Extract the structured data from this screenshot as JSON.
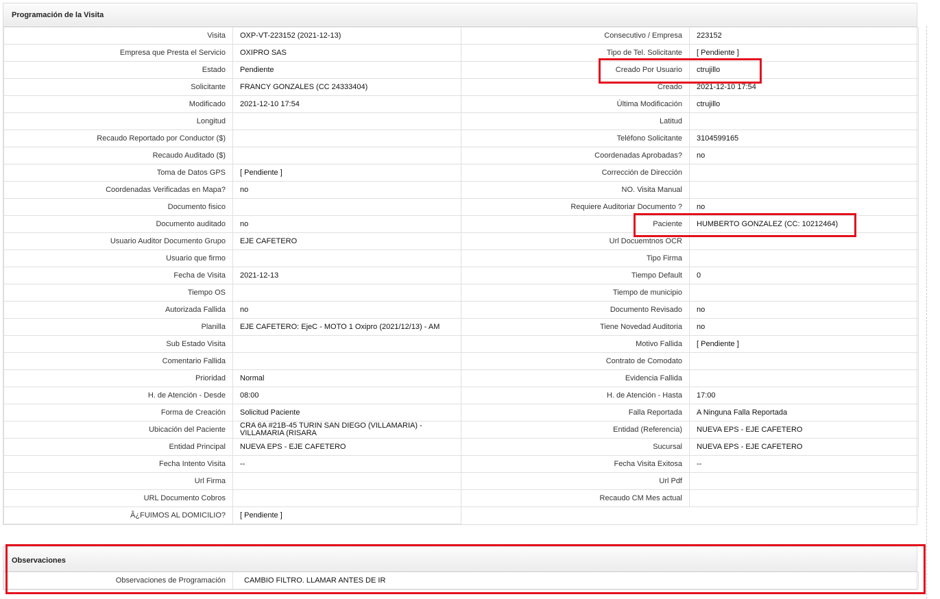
{
  "programacion": {
    "title": "Programación de la Visita",
    "rows": [
      {
        "l1": "Visita",
        "v1": "OXP-VT-223152 (2021-12-13)",
        "l2": "Consecutivo / Empresa",
        "v2": "223152"
      },
      {
        "l1": "Empresa que Presta el Servicio",
        "v1": "OXIPRO SAS",
        "l2": "Tipo de Tel. Solicitante",
        "v2": "[ Pendiente ]"
      },
      {
        "l1": "Estado",
        "v1": "Pendiente",
        "l2": "Creado Por Usuario",
        "v2": "ctrujillo"
      },
      {
        "l1": "Solicitante",
        "v1": "FRANCY GONZALES (CC 24333404)",
        "l2": "Creado",
        "v2": "2021-12-10 17:54"
      },
      {
        "l1": "Modificado",
        "v1": "2021-12-10 17:54",
        "l2": "Última Modificación",
        "v2": "ctrujillo"
      },
      {
        "l1": "Longitud",
        "v1": "",
        "l2": "Latitud",
        "v2": ""
      },
      {
        "l1": "Recaudo Reportado por Conductor ($)",
        "v1": "",
        "l2": "Teléfono Solicitante",
        "v2": "3104599165"
      },
      {
        "l1": "Recaudo Auditado ($)",
        "v1": "",
        "l2": "Coordenadas Aprobadas?",
        "v2": "no"
      },
      {
        "l1": "Toma de Datos GPS",
        "v1": "[ Pendiente ]",
        "l2": "Corrección de Dirección",
        "v2": ""
      },
      {
        "l1": "Coordenadas Verificadas en Mapa?",
        "v1": "no",
        "l2": "NO. Visita Manual",
        "v2": ""
      },
      {
        "l1": "Documento fisico",
        "v1": "",
        "l2": "Requiere Auditoriar Documento ?",
        "v2": "no"
      },
      {
        "l1": "Documento auditado",
        "v1": "no",
        "l2": "Paciente",
        "v2": "HUMBERTO GONZALEZ (CC: 10212464)"
      },
      {
        "l1": "Usuario Auditor Documento Grupo",
        "v1": "EJE CAFETERO",
        "l2": "Url Docuemtnos OCR",
        "v2": ""
      },
      {
        "l1": "Usuario que firmo",
        "v1": "",
        "l2": "Tipo Firma",
        "v2": ""
      },
      {
        "l1": "Fecha de Visita",
        "v1": "2021-12-13",
        "l2": "Tiempo Default",
        "v2": "0"
      },
      {
        "l1": "Tiempo OS",
        "v1": "",
        "l2": "Tiempo de municipio",
        "v2": ""
      },
      {
        "l1": "Autorizada Fallida",
        "v1": "no",
        "l2": "Documento Revisado",
        "v2": "no"
      },
      {
        "l1": "Planilla",
        "v1": "EJE CAFETERO: EjeC - MOTO 1 Oxipro (2021/12/13) - AM",
        "l2": "Tiene Novedad Auditoria",
        "v2": "no"
      },
      {
        "l1": "Sub Estado Visita",
        "v1": "",
        "l2": "Motivo Fallida",
        "v2": "[ Pendiente ]"
      },
      {
        "l1": "Comentario Fallida",
        "v1": "",
        "l2": "Contrato de Comodato",
        "v2": ""
      },
      {
        "l1": "Prioridad",
        "v1": "Normal",
        "l2": "Evidencia Fallida",
        "v2": ""
      },
      {
        "l1": "H. de Atención - Desde",
        "v1": "08:00",
        "l2": "H. de Atención - Hasta",
        "v2": "17:00"
      },
      {
        "l1": "Forma de Creación",
        "v1": "Solicitud Paciente",
        "l2": "Falla Reportada",
        "v2": "A Ninguna Falla Reportada"
      },
      {
        "l1": "Ubicación del Paciente",
        "v1": "CRA 6A #21B-45 TURIN SAN DIEGO (VILLAMARIA) - VILLAMARIA (RISARA",
        "l2": "Entidad (Referencia)",
        "v2": "NUEVA EPS - EJE CAFETERO"
      },
      {
        "l1": "Entidad Principal",
        "v1": "NUEVA EPS - EJE CAFETERO",
        "l2": "Sucursal",
        "v2": "NUEVA EPS - EJE CAFETERO"
      },
      {
        "l1": "Fecha Intento Visita",
        "v1": "--",
        "l2": "Fecha Visita Exitosa",
        "v2": "--"
      },
      {
        "l1": "Url Firma",
        "v1": "",
        "l2": "Url Pdf",
        "v2": ""
      },
      {
        "l1": "URL Documento Cobros",
        "v1": "",
        "l2": "Recaudo CM Mes actual",
        "v2": ""
      },
      {
        "l1": "Â¿FUIMOS AL DOMICILIO?",
        "v1": "[ Pendiente ]"
      }
    ]
  },
  "observaciones": {
    "title": "Observaciones",
    "label": "Observaciones de Programación",
    "value": "CAMBIO FILTRO. LLAMAR ANTES DE IR"
  },
  "highlight_color": "#e3101d"
}
